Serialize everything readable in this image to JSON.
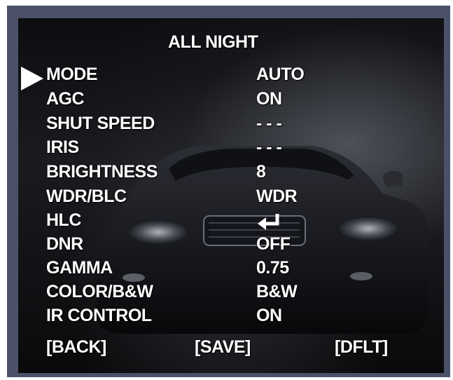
{
  "menu": {
    "title": "ALL NIGHT",
    "selected_index": 0,
    "items": [
      {
        "label": "MODE",
        "value": "AUTO"
      },
      {
        "label": "AGC",
        "value": "ON"
      },
      {
        "label": "SHUT SPEED",
        "value": "- - -"
      },
      {
        "label": "IRIS",
        "value": "- - -"
      },
      {
        "label": "BRIGHTNESS",
        "value": "8"
      },
      {
        "label": "WDR/BLC",
        "value": "WDR"
      },
      {
        "label": "HLC",
        "value": "",
        "value_icon": "enter-icon"
      },
      {
        "label": "DNR",
        "value": "OFF"
      },
      {
        "label": "GAMMA",
        "value": "0.75"
      },
      {
        "label": "COLOR/B&W",
        "value": "B&W"
      },
      {
        "label": "IR CONTROL",
        "value": "ON"
      }
    ]
  },
  "footer": {
    "back_label": "[BACK]",
    "save_label": "[SAVE]",
    "default_label": "[DFLT]"
  },
  "colors": {
    "frame": "#4a5168",
    "text": "#ffffff"
  },
  "icons": {
    "cursor": "selection-arrow-icon",
    "hlc_value": "enter-icon"
  }
}
